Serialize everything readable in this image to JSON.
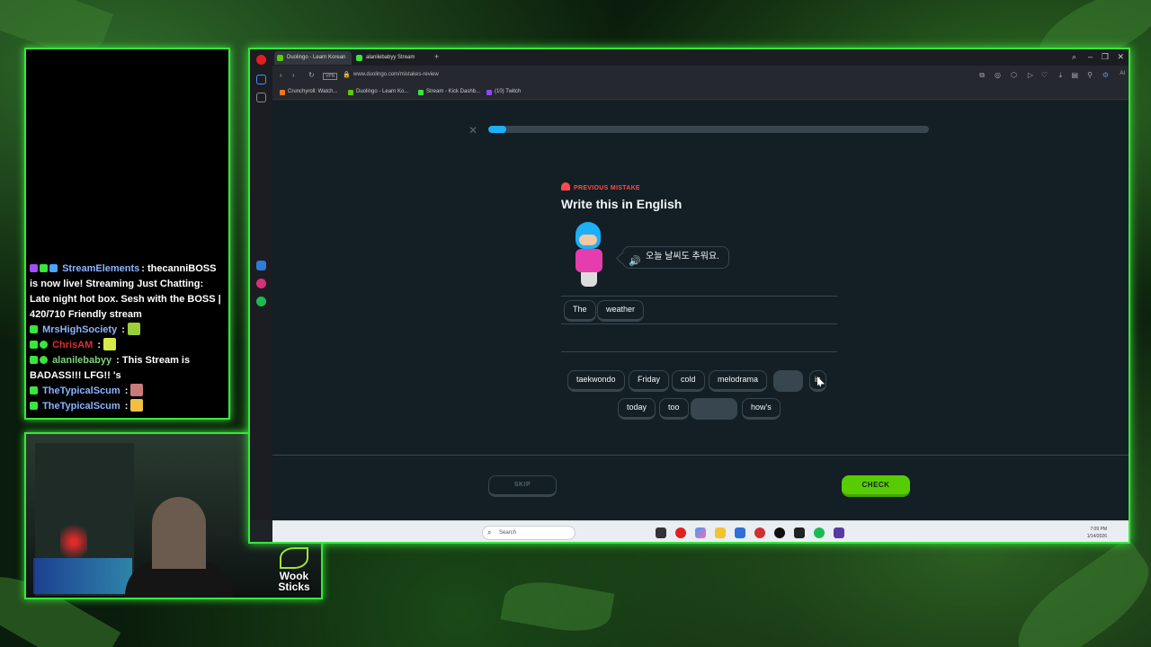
{
  "chat": {
    "messages": [
      {
        "name": "StreamElements",
        "name_color": "#8ab4ff",
        "sep": ": ",
        "text": "thecanniBOSS is now live! Streaming Just Chatting: Late night hot box. Sesh with the BOSS | 420/710 Friendly stream"
      },
      {
        "name": "MrsHighSociety",
        "name_color": "#8ab4ff",
        "sep": " : ",
        "text": ""
      },
      {
        "name": "ChrisAM",
        "name_color": "#e03030",
        "sep": " : ",
        "text": ""
      },
      {
        "name": "alanilebabyy",
        "name_color": "#7ad67a",
        "sep": " : ",
        "text": "This Stream is BADASS!!! LFG!!  's"
      },
      {
        "name": "TheTypicalScum",
        "name_color": "#8ab4ff",
        "sep": " : ",
        "text": ""
      },
      {
        "name": "TheTypicalScum",
        "name_color": "#8ab4ff",
        "sep": " : ",
        "text": ""
      }
    ]
  },
  "webcam": {
    "logo_line1": "Wook",
    "logo_line2": "Sticks"
  },
  "browser": {
    "tabs": [
      {
        "label": "Duolingo - Learn Korean",
        "active": true
      },
      {
        "label": "alanilebabyy Stream",
        "active": false
      }
    ],
    "new_tab": "+",
    "window_controls": {
      "search": "⌕",
      "minimize": "–",
      "restore": "❐",
      "close": "✕"
    },
    "url": "www.duolingo.com/mistakes-review",
    "bookmarks": [
      "Crunchyroll: Watch...",
      "Duolingo - Learn Ko...",
      "Stream - Kick Dashb...",
      "(10) Twitch"
    ]
  },
  "lesson": {
    "progress_percent": 4,
    "label": "PREVIOUS MISTAKE",
    "title": "Write this in English",
    "prompt": "오늘 날씨도 추워요.",
    "answer_words": [
      "The",
      "weather"
    ],
    "bank_row1": [
      "taekwondo",
      "Friday",
      "cold",
      "melodrama",
      "",
      "is"
    ],
    "bank_row2": [
      "today",
      "too",
      "",
      "how's"
    ],
    "skip_label": "SKIP",
    "check_label": "CHECK"
  },
  "taskbar": {
    "search_placeholder": "Search",
    "time": "7:09 PM",
    "date": "1/14/2026"
  },
  "colors": {
    "accent_green": "#39e63a",
    "duo_bg": "#131f24",
    "duo_blue": "#1cb0f6",
    "duo_green": "#58cc02",
    "duo_red": "#ff4b4b"
  }
}
